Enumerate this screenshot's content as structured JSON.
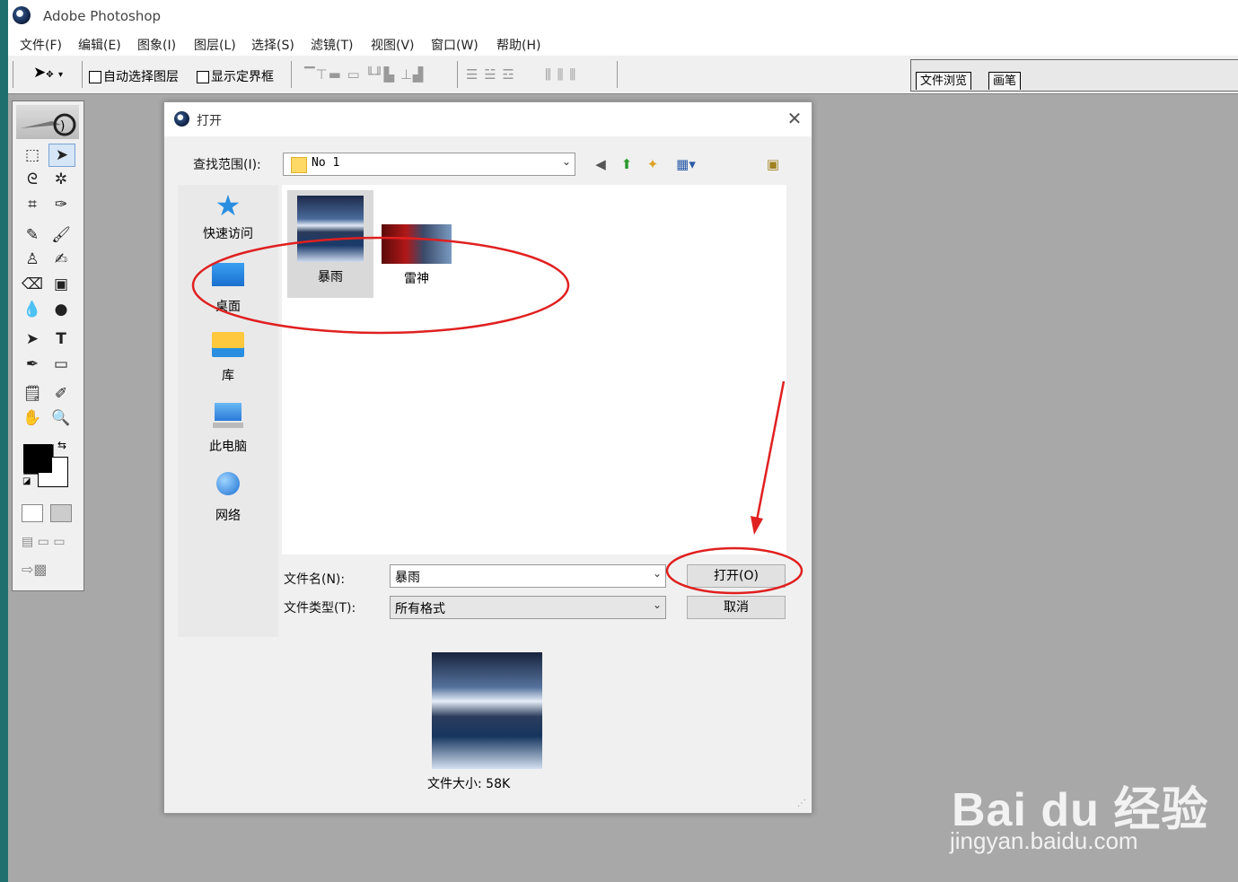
{
  "app": {
    "title": "Adobe Photoshop"
  },
  "menubar": [
    "文件(F)",
    "编辑(E)",
    "图象(I)",
    "图层(L)",
    "选择(S)",
    "滤镜(T)",
    "视图(V)",
    "窗口(W)",
    "帮助(H)"
  ],
  "options_bar": {
    "auto_select_label": "自动选择图层",
    "auto_select_checked": false,
    "show_bounds_label": "显示定界框",
    "show_bounds_checked": false
  },
  "palette_well": {
    "tabs": [
      "文件浏览",
      "画笔"
    ]
  },
  "dialog": {
    "title": "打开",
    "look_in_label": "查找范围(I):",
    "look_in_value": "No 1",
    "places": [
      {
        "label": "快速访问",
        "icon": "star-icon"
      },
      {
        "label": "桌面",
        "icon": "desktop-icon"
      },
      {
        "label": "库",
        "icon": "library-folder-icon"
      },
      {
        "label": "此电脑",
        "icon": "computer-icon"
      },
      {
        "label": "网络",
        "icon": "network-icon"
      }
    ],
    "files": [
      {
        "name": "暴雨",
        "selected": true
      },
      {
        "name": "雷神",
        "selected": false
      }
    ],
    "filename_label": "文件名(N):",
    "filename_value": "暴雨",
    "filetype_label": "文件类型(T):",
    "filetype_value": "所有格式",
    "open_button": "打开(O)",
    "cancel_button": "取消",
    "file_size": "文件大小: 58K"
  },
  "colors": {
    "annotation": "#e02020",
    "foreground": "#000000",
    "background": "#ffffff"
  },
  "watermark": {
    "logo": "Bai du 经验",
    "url": "jingyan.baidu.com"
  }
}
